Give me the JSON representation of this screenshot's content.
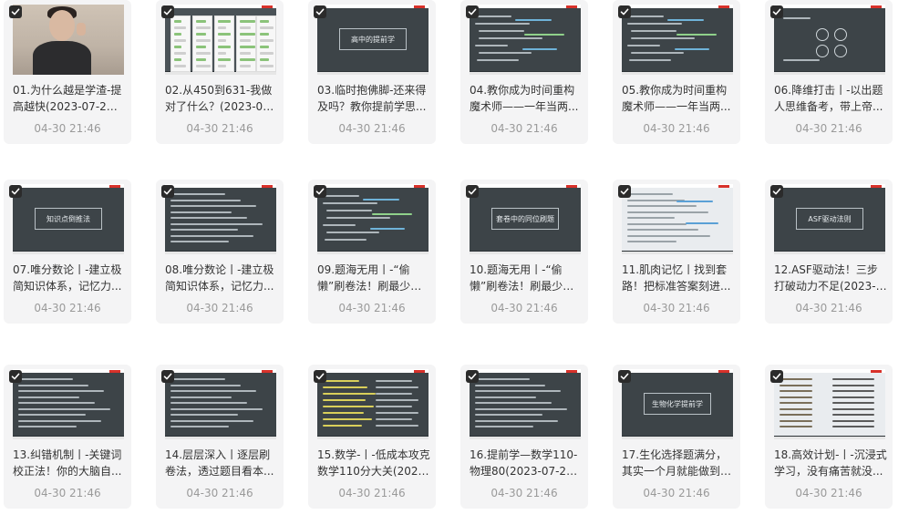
{
  "items": [
    {
      "title": "01.为什么越是学渣-提高越快(2023-07-26)....",
      "date": "04-30 21:46",
      "thumb_type": "photo",
      "slide_text": ""
    },
    {
      "title": "02.从450到631-我做对了什么？(2023-07-2...",
      "date": "04-30 21:46",
      "thumb_type": "chat",
      "slide_text": ""
    },
    {
      "title": "03.临时抱佛脚-还来得及吗？教你提前学思...",
      "date": "04-30 21:46",
      "thumb_type": "title",
      "slide_text": "高中的提前学"
    },
    {
      "title": "04.教你成为时间重构魔术师——一年当两...",
      "date": "04-30 21:46",
      "thumb_type": "notes",
      "slide_text": ""
    },
    {
      "title": "05.教你成为时间重构魔术师——一年当两...",
      "date": "04-30 21:46",
      "thumb_type": "notes",
      "slide_text": ""
    },
    {
      "title": "06.降维打击丨-以出题人思维备考，带上帝...",
      "date": "04-30 21:46",
      "thumb_type": "diagram",
      "slide_text": ""
    },
    {
      "title": "07.唯分数论丨-建立极简知识体系，记忆力...",
      "date": "04-30 21:46",
      "thumb_type": "title",
      "slide_text": "知识点倒推法"
    },
    {
      "title": "08.唯分数论丨-建立极简知识体系，记忆力...",
      "date": "04-30 21:46",
      "thumb_type": "text",
      "slide_text": ""
    },
    {
      "title": "09.题海无用丨-“偷懒”刷卷法！刷最少的题...",
      "date": "04-30 21:46",
      "thumb_type": "notes",
      "slide_text": ""
    },
    {
      "title": "10.题海无用丨-“偷懒”刷卷法！刷最少的题...",
      "date": "04-30 21:46",
      "thumb_type": "title",
      "slide_text": "套卷中的同位刷题"
    },
    {
      "title": "11.肌肉记忆丨找到套路！把标准答案刻进...",
      "date": "04-30 21:46",
      "thumb_type": "doc",
      "slide_text": ""
    },
    {
      "title": "12.ASF驱动法！三步打破动力不足(2023-07-...",
      "date": "04-30 21:46",
      "thumb_type": "title",
      "slide_text": "ASF驱动法则"
    },
    {
      "title": "13.纠错机制丨-关键词校正法！你的大脑自...",
      "date": "04-30 21:46",
      "thumb_type": "text",
      "slide_text": ""
    },
    {
      "title": "14.层层深入丨逐层刷卷法，透过题目看本...",
      "date": "04-30 21:46",
      "thumb_type": "text",
      "slide_text": ""
    },
    {
      "title": "15.数学-丨-低成本攻克数学110分大关(2023...",
      "date": "04-30 21:46",
      "thumb_type": "code",
      "slide_text": ""
    },
    {
      "title": "16.提前学—数学110-物理80(2023-07-26)....",
      "date": "04-30 21:46",
      "thumb_type": "text",
      "slide_text": ""
    },
    {
      "title": "17.生化选择题满分，其实一个月就能做到(20...",
      "date": "04-30 21:46",
      "thumb_type": "title",
      "slide_text": "生物化学提前学"
    },
    {
      "title": "18.高效计划-丨-沉浸式学习，没有痛苦就没...",
      "date": "04-30 21:46",
      "thumb_type": "notebook",
      "slide_text": ""
    }
  ],
  "colors": {
    "card_bg": "#f4f4f5",
    "slide_bg": "#3d4448",
    "check_bg": "#2b2b2b",
    "title_text": "#333333",
    "date_text": "#9a9a9a"
  }
}
